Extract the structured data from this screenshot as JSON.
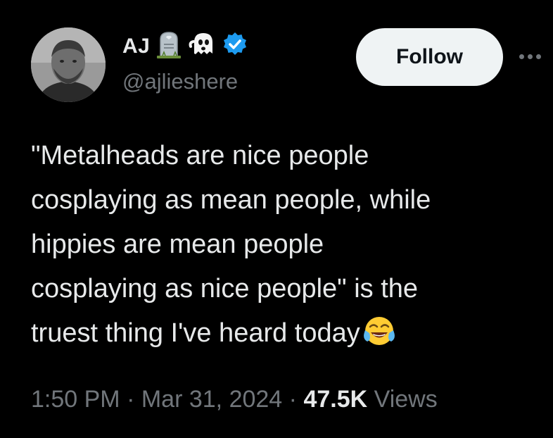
{
  "user": {
    "display_name": "AJ",
    "handle": "@ajlieshere",
    "badges": [
      "headstone-icon",
      "ghost-icon",
      "verified-icon"
    ],
    "verified_color": "#1d9bf0"
  },
  "actions": {
    "follow_label": "Follow",
    "more_icon": "more-icon"
  },
  "tweet": {
    "lines": [
      "\"Metalheads are nice people",
      "cosplaying as mean people, while",
      "hippies are mean people",
      "cosplaying as nice people\" is the",
      "truest thing I've heard today"
    ],
    "emoji": "face-with-tears-of-joy-icon"
  },
  "meta": {
    "time": "1:50 PM",
    "separator": "·",
    "date": "Mar 31, 2024",
    "views_count": "47.5K",
    "views_label": "Views"
  },
  "colors": {
    "background": "#000000",
    "text": "#e7e9ea",
    "secondary": "#71767b",
    "follow_bg": "#eff3f4"
  }
}
